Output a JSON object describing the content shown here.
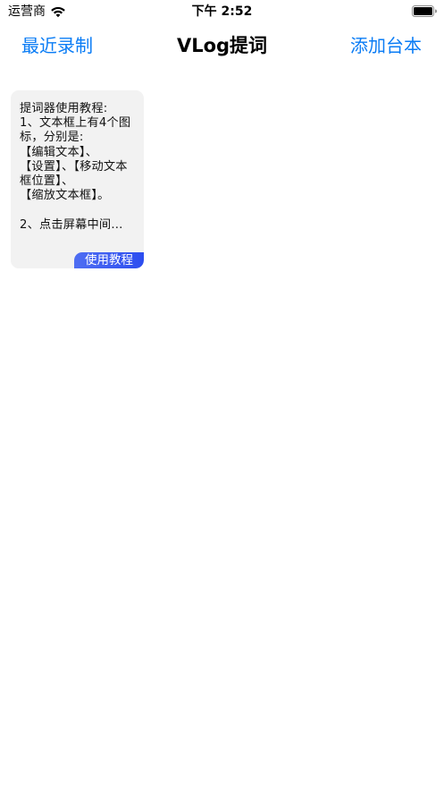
{
  "status_bar": {
    "carrier": "运营商",
    "time": "下午 2:52",
    "wifi_icon": "wifi-icon",
    "battery_icon": "battery-icon"
  },
  "nav": {
    "left_label": "最近录制",
    "title": "VLog提词",
    "right_label": "添加台本"
  },
  "scripts": [
    {
      "text": "提词器使用教程:\n1、文本框上有4个图标，分别是:\n【编辑文本】、\n【设置】、【移动文本框位置】、\n【缩放文本框】。\n\n2、点击屏幕中间…",
      "badge": "使用教程"
    }
  ],
  "colors": {
    "accent": "#0a7cf5",
    "card_background": "#f2f2f2",
    "badge_gradient_start": "#4f6ef2",
    "badge_gradient_end": "#2c4df0"
  }
}
